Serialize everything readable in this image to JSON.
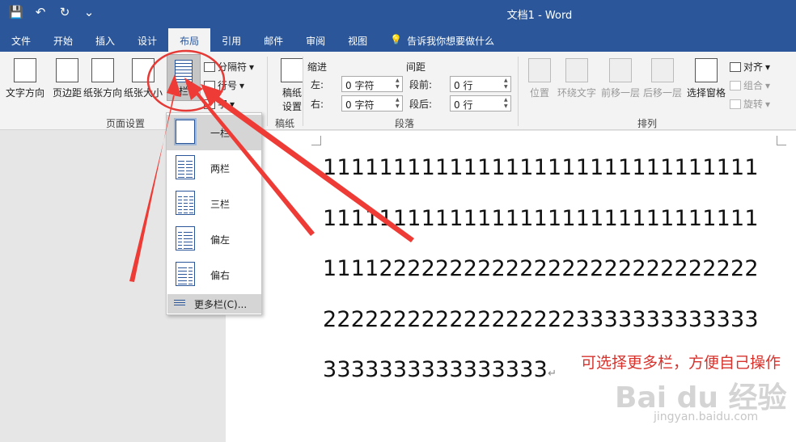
{
  "titlebar": {
    "title": "文档1 - Word",
    "save_icon": "💾",
    "undo_icon": "↶",
    "redo_icon": "↻",
    "customize_icon": "⌄"
  },
  "tabs": [
    "文件",
    "开始",
    "插入",
    "设计",
    "布局",
    "引用",
    "邮件",
    "审阅",
    "视图"
  ],
  "active_tab": "布局",
  "tellme": "告诉我你想要做什么",
  "ribbon": {
    "page_setup": {
      "text_direction": "文字方向",
      "margins": "页边距",
      "orientation": "纸张方向",
      "size": "纸张大小",
      "columns": "栏",
      "breaks": "分隔符",
      "line_numbers": "行号",
      "hyphenation": "字",
      "group_label": "页面设置"
    },
    "draft": {
      "label_1": "稿纸",
      "label_2": "设置",
      "group_label": "稿纸"
    },
    "paragraph": {
      "indent_header": "缩进",
      "spacing_header": "间距",
      "left_label": "左:",
      "right_label": "右:",
      "left_value": "0 字符",
      "right_value": "0 字符",
      "before_label": "段前:",
      "after_label": "段后:",
      "before_value": "0 行",
      "after_value": "0 行",
      "group_label": "段落"
    },
    "arrange": {
      "position": "位置",
      "wrap_text": "环绕文字",
      "bring_forward": "前移一层",
      "send_backward": "后移一层",
      "selection_pane": "选择窗格",
      "align": "对齐",
      "group": "组合",
      "rotate": "旋转",
      "group_label": "排列"
    }
  },
  "dropdown": {
    "items": [
      "一栏",
      "两栏",
      "三栏",
      "偏左",
      "偏右"
    ],
    "more": "更多栏(C)..."
  },
  "document": {
    "lines": [
      "1111111111111111111111111111111",
      "1111111111111111111111111111111",
      "1111222222222222222222222222222",
      "2222222222222222223333333333333",
      "3333333333333333"
    ]
  },
  "annotation": "可选择更多栏，方便自己操作",
  "watermark": {
    "logo": "Bai du 经验",
    "url": "jingyan.baidu.com"
  },
  "colors": {
    "word_blue": "#2b579a",
    "annotation_red": "#e53935"
  }
}
